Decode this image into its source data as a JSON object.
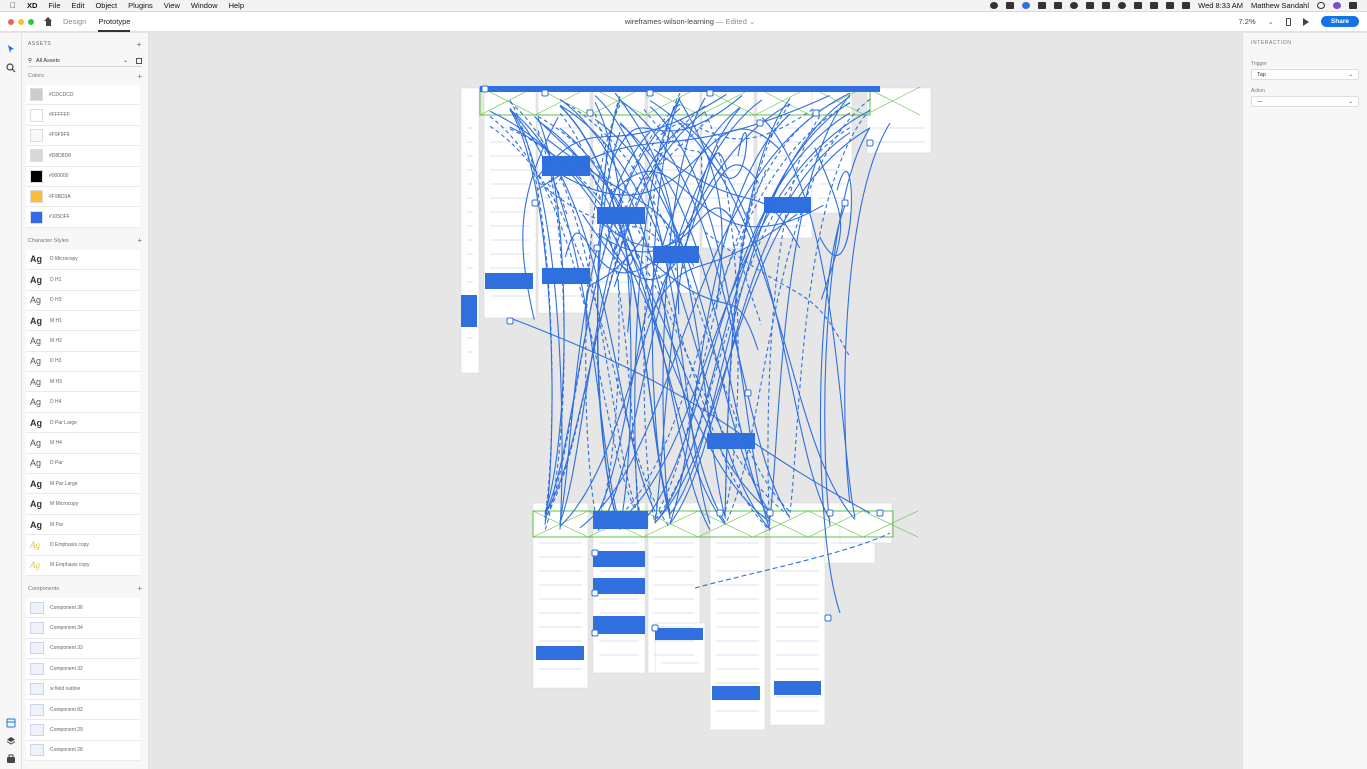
{
  "menubar": {
    "app": "XD",
    "menus": [
      "File",
      "Edit",
      "Object",
      "Plugins",
      "View",
      "Window",
      "Help"
    ],
    "clock": "Wed 8:33 AM",
    "user": "Matthew Sandahl"
  },
  "titlebar": {
    "tabs": [
      "Design",
      "Prototype"
    ],
    "active_tab": "Prototype",
    "document": "wireframes-wilson-learning",
    "status": "— Edited",
    "zoom": "7.2%",
    "share_label": "Share"
  },
  "assets": {
    "header": "ASSETS",
    "filter": "All Assets",
    "colors_title": "Colors",
    "colors": [
      {
        "label": "#CDCDCD",
        "hex": "#CDCDCD"
      },
      {
        "label": "#FFFFFF",
        "hex": "#FFFFFF"
      },
      {
        "label": "#F9F9F9",
        "hex": "#F9F9F9"
      },
      {
        "label": "#D8D8D8",
        "hex": "#D8D8D8"
      },
      {
        "label": "#000000",
        "hex": "#000000"
      },
      {
        "label": "#F9BD3A",
        "hex": "#F9BD3A"
      },
      {
        "label": "#105DFF",
        "hex": "#3369E8"
      }
    ],
    "char_title": "Character Styles",
    "char_styles": [
      {
        "label": "D Microcopy",
        "style": "bold"
      },
      {
        "label": "D H1",
        "style": "bold"
      },
      {
        "label": "D H3",
        "style": "light"
      },
      {
        "label": "M H1",
        "style": "bold"
      },
      {
        "label": "M H2",
        "style": "light"
      },
      {
        "label": "D H3",
        "style": "light"
      },
      {
        "label": "M H3",
        "style": "light"
      },
      {
        "label": "D H4",
        "style": "light"
      },
      {
        "label": "D Par Large",
        "style": "bold"
      },
      {
        "label": "M H4",
        "style": "light"
      },
      {
        "label": "D Par",
        "style": "light"
      },
      {
        "label": "M Par Large",
        "style": "bold"
      },
      {
        "label": "M Microcopy",
        "style": "bold"
      },
      {
        "label": "M Par",
        "style": "bold"
      },
      {
        "label": "D Emphasis copy",
        "style": "yellow"
      },
      {
        "label": "M Emphasis copy",
        "style": "yellow"
      }
    ],
    "components_title": "Components",
    "components": [
      "Component 36",
      "Component 34",
      "Component 33",
      "Component 32",
      "w field outline",
      "Component 82",
      "Component 29",
      "Component 28"
    ]
  },
  "inspector": {
    "title": "INTERACTION",
    "trigger_label": "Trigger",
    "trigger_value": "Tap",
    "action_label": "Action",
    "action_value": "—"
  },
  "colors": {
    "accent": "#1473e6",
    "wire_blue": "#2f6fde",
    "artboard_green": "#5ec043"
  }
}
